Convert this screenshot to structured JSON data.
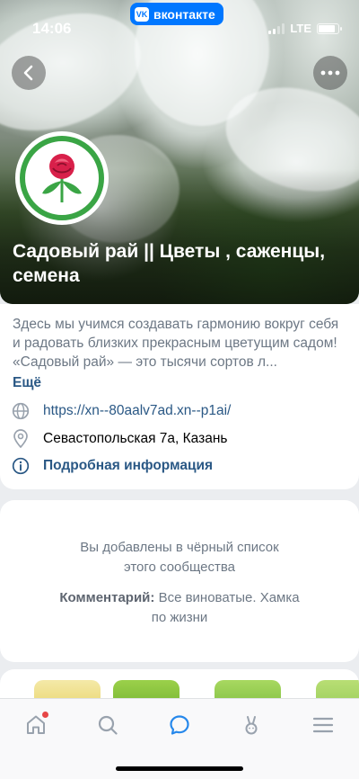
{
  "status_bar": {
    "time": "14:06",
    "app_badge": "вконтакте",
    "network": "LTE",
    "battery_level": 0.85
  },
  "community": {
    "name": "Садовый рай || Цветы , саженцы, семена",
    "description": "Здесь мы учимся создавать гармонию вокруг себя и радовать близких прекрасным цветущим садом! «Садовый рай» — это тысячи сортов л...",
    "more_label": "Ещё",
    "website": "https://xn--80aalv7ad.xn--p1ai/",
    "address": "Севастопольская 7а, Казань",
    "details_label": "Подробная информация"
  },
  "blacklist": {
    "message": "Вы добавлены в чёрный список этого сообщества",
    "comment_label": "Комментарий:",
    "comment_text": " Все виноватые. Хамка по жизни"
  },
  "colors": {
    "accent": "#2a5885",
    "vk_blue": "#0077ff",
    "logo_green": "#3aa545",
    "notification": "#e64646"
  },
  "tabbar": {
    "items": [
      "home-icon",
      "search-icon",
      "messages-icon",
      "clips-icon",
      "menu-icon"
    ],
    "active": "messages-icon"
  }
}
